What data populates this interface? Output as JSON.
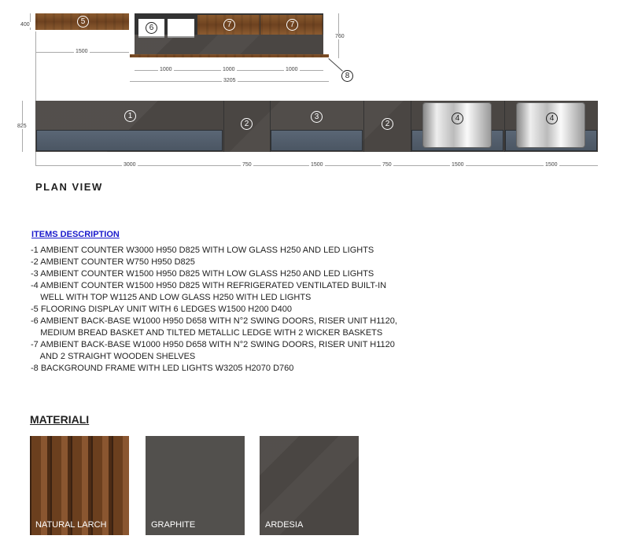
{
  "elevation": {
    "item5": {
      "num": "5",
      "height": "400",
      "width": "1500"
    },
    "back": {
      "nums": [
        "6",
        "7",
        "7"
      ],
      "height": "760",
      "widths": [
        "1000",
        "1000",
        "1000"
      ],
      "total": "3205",
      "frame_num": "8"
    }
  },
  "plan": {
    "height": "825",
    "sections": [
      {
        "num": "1",
        "width": "3000"
      },
      {
        "num": "2",
        "width": "750"
      },
      {
        "num": "3",
        "width": "1500"
      },
      {
        "num": "2",
        "width": "750"
      },
      {
        "num": "4",
        "width": "1500"
      },
      {
        "num": "4",
        "width": "1500"
      }
    ],
    "title": "PLAN VIEW"
  },
  "items": {
    "title": "ITEMS DESCRIPTION",
    "lines": [
      "-1 AMBIENT COUNTER W3000 H950 D825 WITH LOW GLASS H250 AND LED LIGHTS",
      "-2 AMBIENT COUNTER W750 H950 D825",
      "-3 AMBIENT COUNTER W1500 H950 D825 WITH LOW GLASS H250 AND LED LIGHTS",
      "-4 AMBIENT COUNTER W1500 H950 D825 WITH REFRIGERATED VENTILATED BUILT-IN",
      "    WELL WITH TOP W1125 AND LOW GLASS H250 WITH LED LIGHTS",
      "-5 FLOORING DISPLAY UNIT WITH 6 LEDGES W1500 H200 D400",
      "-6 AMBIENT BACK-BASE W1000 H950 D658 WITH N°2 SWING DOORS, RISER UNIT H1120,",
      "    MEDIUM BREAD BASKET AND TILTED METALLIC LEDGE WITH 2 WICKER BASKETS",
      "-7 AMBIENT BACK-BASE W1000 H950 D658 WITH N°2 SWING DOORS, RISER UNIT H1120",
      "    AND 2 STRAIGHT WOODEN SHELVES",
      "-8 BACKGROUND FRAME WITH LED LIGHTS W3205 H2070 D760"
    ],
    "title_color": "#1a1acc"
  },
  "materials": {
    "title": "MATERIALI",
    "swatches": [
      "NATURAL LARCH",
      "GRAPHITE",
      "ARDESIA"
    ]
  }
}
